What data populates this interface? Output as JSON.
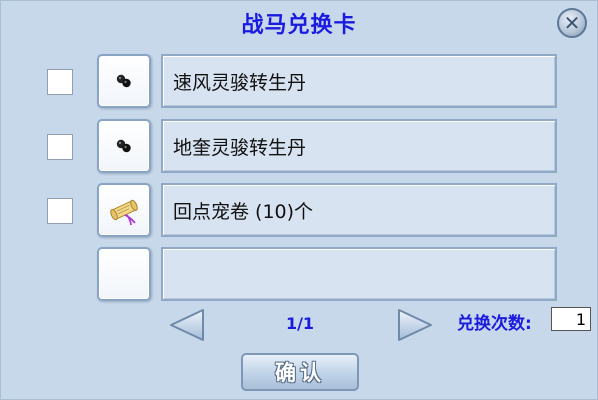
{
  "window": {
    "title": "战马兑换卡"
  },
  "items": [
    {
      "name": "速风灵骏转生丹",
      "icon": "black-pill-icon",
      "checked": false
    },
    {
      "name": "地奎灵骏转生丹",
      "icon": "black-pill-icon",
      "checked": false
    },
    {
      "name": "回点宠卷 (10)个",
      "icon": "scroll-icon",
      "checked": false
    },
    {
      "name": "",
      "icon": "",
      "checked": false
    }
  ],
  "pager": {
    "page": "1/1"
  },
  "exchange": {
    "label": "兑换次数:",
    "value": "1"
  },
  "buttons": {
    "confirm": "确认"
  },
  "colors": {
    "panel_bg": "#c7d8ea",
    "accent_text": "#1b1be0"
  }
}
